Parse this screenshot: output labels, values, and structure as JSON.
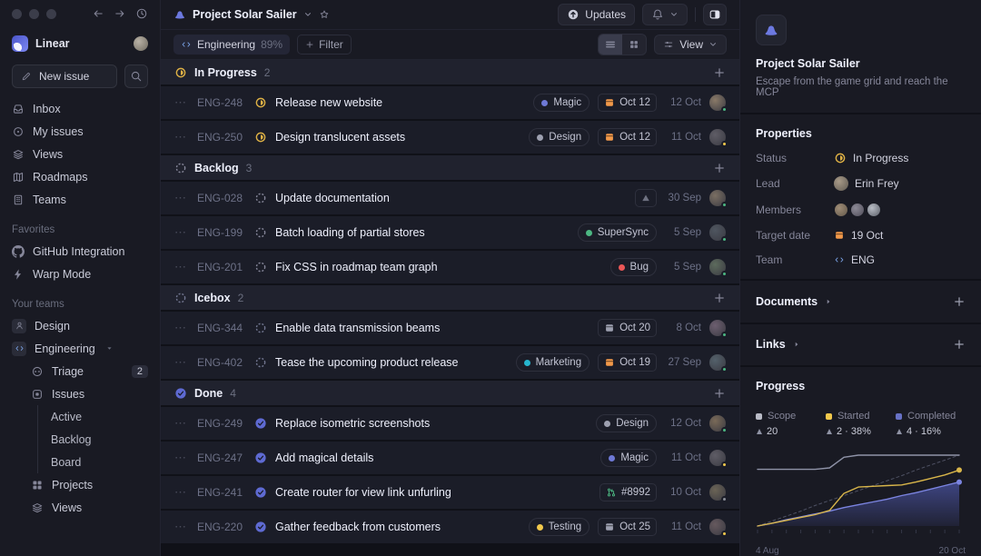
{
  "sidebar": {
    "workspace_name": "Linear",
    "new_issue_label": "New issue",
    "nav": [
      {
        "label": "Inbox",
        "icon": "inbox"
      },
      {
        "label": "My issues",
        "icon": "target"
      },
      {
        "label": "Views",
        "icon": "layers"
      },
      {
        "label": "Roadmaps",
        "icon": "map"
      },
      {
        "label": "Teams",
        "icon": "building"
      }
    ],
    "favorites_title": "Favorites",
    "favorites": [
      {
        "label": "GitHub Integration",
        "icon": "github"
      },
      {
        "label": "Warp Mode",
        "icon": "bolt"
      }
    ],
    "teams_title": "Your teams",
    "teams": [
      {
        "label": "Design",
        "icon": "person"
      },
      {
        "label": "Engineering",
        "icon": "code",
        "expanded": true,
        "children": [
          {
            "label": "Triage",
            "icon": "triage",
            "badge": "2"
          },
          {
            "label": "Issues",
            "icon": "issue-square"
          },
          {
            "label": "Active",
            "indent": true
          },
          {
            "label": "Backlog",
            "indent": true
          },
          {
            "label": "Board",
            "indent": true
          },
          {
            "label": "Projects",
            "icon": "grid"
          },
          {
            "label": "Views",
            "icon": "layers"
          }
        ]
      }
    ]
  },
  "header": {
    "project": "Project Solar Sailer",
    "updates_label": "Updates"
  },
  "toolbar": {
    "team": "Engineering",
    "team_pct": "89%",
    "filter_label": "Filter",
    "view_label": "View"
  },
  "groups": [
    {
      "name": "In Progress",
      "count": "2",
      "status": "inprogress",
      "rows": [
        {
          "id": "ENG-248",
          "title": "Release new website",
          "label": {
            "text": "Magic",
            "color": "#6e79d6"
          },
          "due": {
            "text": "Oct 12",
            "color": "#f2994a"
          },
          "date": "12 Oct",
          "avatar": {
            "bg": "#8a7a68",
            "dot": "#4cb782"
          }
        },
        {
          "id": "ENG-250",
          "title": "Design translucent assets",
          "label": {
            "text": "Design",
            "color": "#9da0b0"
          },
          "due": {
            "text": "Oct 12",
            "color": "#f2994a"
          },
          "date": "11 Oct",
          "avatar": {
            "bg": "#5f5d66",
            "dot": "#f2c94c"
          }
        }
      ]
    },
    {
      "name": "Backlog",
      "count": "3",
      "status": "backlog",
      "rows": [
        {
          "id": "ENG-028",
          "title": "Update documentation",
          "warn": true,
          "date": "30 Sep",
          "avatar": {
            "bg": "#7b6f63",
            "dot": "#4cb782"
          }
        },
        {
          "id": "ENG-199",
          "title": "Batch loading of partial stores",
          "label": {
            "text": "SuperSync",
            "color": "#4cb782"
          },
          "date": "5 Sep",
          "avatar": {
            "bg": "#4f5660",
            "dot": "#4cb782"
          }
        },
        {
          "id": "ENG-201",
          "title": "Fix CSS in roadmap team graph",
          "label": {
            "text": "Bug",
            "color": "#eb5757"
          },
          "date": "5 Sep",
          "avatar": {
            "bg": "#5d6b5d",
            "dot": "#4cb782"
          }
        }
      ]
    },
    {
      "name": "Icebox",
      "count": "2",
      "status": "icebox",
      "rows": [
        {
          "id": "ENG-344",
          "title": "Enable data transmission beams",
          "due": {
            "text": "Oct 20",
            "color": "#9da0b0"
          },
          "date": "8 Oct",
          "avatar": {
            "bg": "#6d5f70",
            "dot": "#4cb782"
          }
        },
        {
          "id": "ENG-402",
          "title": "Tease the upcoming product release",
          "label": {
            "text": "Marketing",
            "color": "#26b5ce"
          },
          "due": {
            "text": "Oct 19",
            "color": "#f2994a"
          },
          "date": "27 Sep",
          "avatar": {
            "bg": "#54616b",
            "dot": "#4cb782"
          }
        }
      ]
    },
    {
      "name": "Done",
      "count": "4",
      "status": "done",
      "rows": [
        {
          "id": "ENG-249",
          "title": "Replace isometric screenshots",
          "label": {
            "text": "Design",
            "color": "#9da0b0"
          },
          "date": "12 Oct",
          "avatar": {
            "bg": "#7a6a58",
            "dot": "#4cb782"
          }
        },
        {
          "id": "ENG-247",
          "title": "Add magical details",
          "label": {
            "text": "Magic",
            "color": "#6e79d6"
          },
          "date": "11 Oct",
          "avatar": {
            "bg": "#5f5d66",
            "dot": "#f2c94c"
          }
        },
        {
          "id": "ENG-241",
          "title": "Create router for view link unfurling",
          "pr": {
            "text": "#8992",
            "color": "#4cb782"
          },
          "date": "10 Oct",
          "avatar": {
            "bg": "#6b6456",
            "dot": "#8a8f98"
          }
        },
        {
          "id": "ENG-220",
          "title": "Gather feedback from customers",
          "label": {
            "text": "Testing",
            "color": "#f2c94c"
          },
          "due": {
            "text": "Oct 25",
            "color": "#9da0b0"
          },
          "date": "11 Oct",
          "avatar": {
            "bg": "#66595e",
            "dot": "#f2c94c"
          }
        }
      ]
    }
  ],
  "panel": {
    "title": "Project Solar Sailer",
    "description": "Escape from the game grid and reach the MCP",
    "properties_title": "Properties",
    "properties": {
      "status_label": "Status",
      "status_value": "In Progress",
      "lead_label": "Lead",
      "lead_value": "Erin Frey",
      "members_label": "Members",
      "target_label": "Target date",
      "target_value": "19 Oct",
      "team_label": "Team",
      "team_value": "ENG"
    },
    "documents_title": "Documents",
    "links_title": "Links",
    "progress_title": "Progress",
    "legend": [
      {
        "name": "Scope",
        "value": "20",
        "color": "#b9bbc6"
      },
      {
        "name": "Started",
        "value": "2 · 38%",
        "color": "#f2c94c"
      },
      {
        "name": "Completed",
        "value": "4 · 16%",
        "color": "#6771c5"
      }
    ]
  },
  "chart_data": {
    "type": "area",
    "title": "Progress",
    "x_axis": {
      "start_label": "4 Aug",
      "end_label": "20 Oct",
      "ticks": 15
    },
    "ylim": [
      0,
      100
    ],
    "legend_position": "top",
    "series": [
      {
        "name": "Projected",
        "style": "dashed",
        "color": "#4e5163",
        "values": [
          0,
          7,
          14,
          21,
          29,
          36,
          43,
          50,
          57,
          64,
          71,
          79,
          86,
          93,
          100
        ]
      },
      {
        "name": "Completed",
        "color": "#7b84e0",
        "fill": true,
        "marker_end": true,
        "values": [
          0,
          4,
          9,
          13,
          17,
          21,
          26,
          30,
          34,
          38,
          43,
          47,
          52,
          57,
          62
        ]
      },
      {
        "name": "Scope",
        "color": "#8f93a8",
        "values": [
          80,
          80,
          80,
          80,
          80,
          82,
          97,
          100,
          100,
          100,
          100,
          100,
          100,
          100,
          100
        ]
      },
      {
        "name": "Started",
        "color": "#d9b64a",
        "marker_end": true,
        "values": [
          0,
          4,
          8,
          12,
          16,
          22,
          46,
          55,
          56,
          57,
          58,
          62,
          67,
          72,
          79
        ]
      }
    ]
  }
}
